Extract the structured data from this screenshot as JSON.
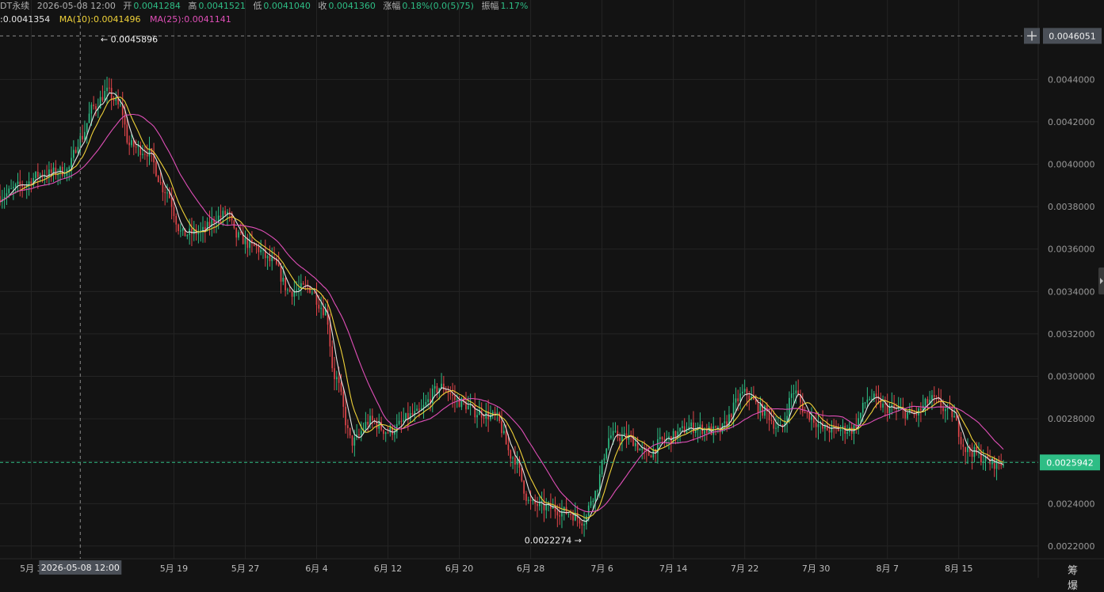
{
  "header": {
    "symbol": "DT永续",
    "time": "2026-05-08 12:00",
    "open_label": "开",
    "open": "0.0041284",
    "high_label": "高",
    "high": "0.0041521",
    "low_label": "低",
    "low": "0.0041040",
    "close_label": "收",
    "close": "0.0041360",
    "change_label": "涨幅",
    "change": "0.18%(0.0(5)75)",
    "amplitude_label": "振幅",
    "amplitude": "1.17%"
  },
  "ma": {
    "ma5": ":0.0041354",
    "ma10": "MA(10):0.0041496",
    "ma25": "MA(25):0.0041141"
  },
  "footer": {
    "glyphs": "筹 爆"
  },
  "colors": {
    "background": "#131313",
    "grid": "#242424",
    "up": "#2ebd85",
    "down": "#e0454a",
    "ma5": "#e6e6e6",
    "ma10": "#f0d239",
    "ma25": "#e04fb8",
    "last_price_bg": "#2ebd85"
  },
  "chart_data": {
    "type": "line",
    "subtype": "candlestick-with-moving-averages",
    "y_axis": {
      "ylim": [
        0.00214,
        0.00464
      ],
      "ticks": [
        "0.0044000",
        "0.0042000",
        "0.0040000",
        "0.0038000",
        "0.0036000",
        "0.0034000",
        "0.0032000",
        "0.0030000",
        "0.0028000",
        "0.0026000",
        "0.0024000",
        "0.0022000"
      ],
      "tick_values": [
        0.0044,
        0.0042,
        0.004,
        0.0038,
        0.0036,
        0.0034,
        0.0032,
        0.003,
        0.0028,
        0.0026,
        0.0024,
        0.0022
      ]
    },
    "x_axis": {
      "ticks": [
        "5月 3",
        "5月 19",
        "5月 27",
        "6月 4",
        "6月 12",
        "6月 20",
        "6月 28",
        "7月 6",
        "7月 14",
        "7月 22",
        "7月 30",
        "8月 7",
        "8月 15"
      ],
      "tick_days": [
        -8,
        8,
        16,
        24,
        32,
        40,
        48,
        56,
        64,
        72,
        80,
        88,
        96
      ],
      "day_min": -11.5,
      "day_max": 101,
      "cursor_label": "2026-05-08 12:00",
      "cursor_day": -2.5
    },
    "crosshair_price": "0.0046051",
    "crosshair_value": 0.0046051,
    "last_price": "0.0025942",
    "last_value": 0.0025942,
    "annotations": [
      {
        "label": "0.0045896",
        "day": -0.4,
        "value": 0.0045896,
        "arrow": "left"
      },
      {
        "label": "0.0022274",
        "day": 53.9,
        "value": 0.0022274,
        "arrow": "right"
      }
    ],
    "anchors": [
      [
        -11.5,
        0.00385
      ],
      [
        -9,
        0.0039
      ],
      [
        -7,
        0.00395
      ],
      [
        -4,
        0.00397
      ],
      [
        -2.5,
        0.00412
      ],
      [
        -1,
        0.00427
      ],
      [
        0.5,
        0.00434
      ],
      [
        2,
        0.00427
      ],
      [
        3,
        0.00409
      ],
      [
        5,
        0.00406
      ],
      [
        7,
        0.00388
      ],
      [
        9,
        0.00367
      ],
      [
        11,
        0.00368
      ],
      [
        13,
        0.00375
      ],
      [
        14,
        0.00377
      ],
      [
        15,
        0.00366
      ],
      [
        17,
        0.00361
      ],
      [
        19,
        0.00354
      ],
      [
        21,
        0.0034
      ],
      [
        23,
        0.00342
      ],
      [
        25,
        0.00331
      ],
      [
        26,
        0.003
      ],
      [
        28,
        0.00269
      ],
      [
        30,
        0.00279
      ],
      [
        32,
        0.00274
      ],
      [
        35,
        0.00282
      ],
      [
        38,
        0.00295
      ],
      [
        40,
        0.00288
      ],
      [
        42,
        0.00283
      ],
      [
        44,
        0.00281
      ],
      [
        46,
        0.00262
      ],
      [
        48,
        0.0024
      ],
      [
        50,
        0.00238
      ],
      [
        52,
        0.00236
      ],
      [
        54,
        0.00232
      ],
      [
        55,
        0.00244
      ],
      [
        57,
        0.00272
      ],
      [
        59,
        0.00271
      ],
      [
        61,
        0.00263
      ],
      [
        63,
        0.0027
      ],
      [
        66,
        0.00276
      ],
      [
        69,
        0.00274
      ],
      [
        72,
        0.00292
      ],
      [
        74,
        0.00284
      ],
      [
        76,
        0.00275
      ],
      [
        77.5,
        0.00293
      ],
      [
        79,
        0.00282
      ],
      [
        81,
        0.00275
      ],
      [
        84,
        0.00275
      ],
      [
        86,
        0.0029
      ],
      [
        88,
        0.00285
      ],
      [
        91,
        0.00282
      ],
      [
        93,
        0.00289
      ],
      [
        95,
        0.00283
      ],
      [
        97,
        0.00265
      ],
      [
        100,
        0.00259
      ]
    ]
  }
}
